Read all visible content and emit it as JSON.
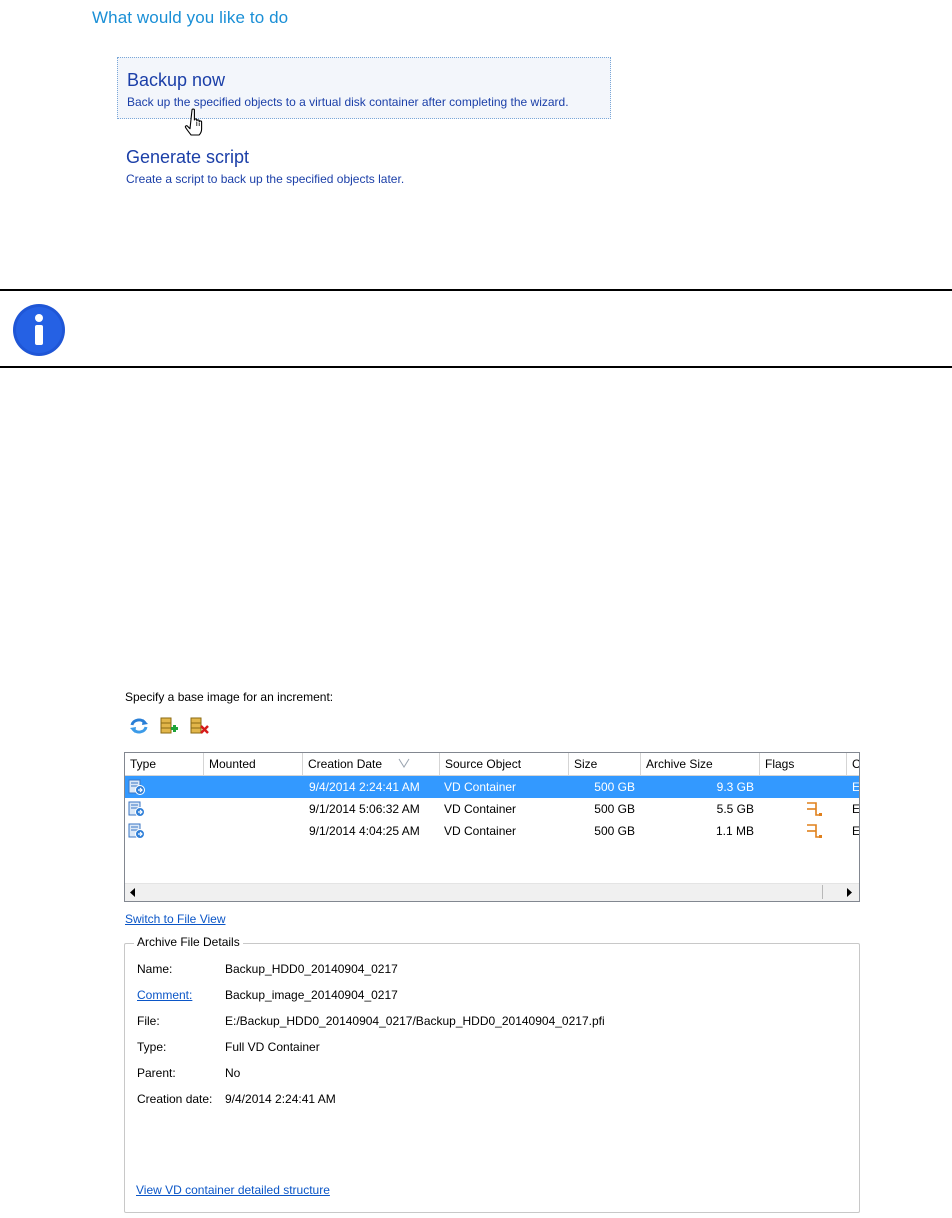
{
  "wizard": {
    "title": "What would you like to do",
    "options": [
      {
        "title": "Backup now",
        "description": "Back up the specified objects to a virtual disk container after completing the wizard."
      },
      {
        "title": "Generate script",
        "description": "Create a script to back up the specified objects later."
      }
    ]
  },
  "note": {
    "icon": "info-icon"
  },
  "base_image": {
    "label": "Specify a base image for an increment:",
    "toolbar": [
      {
        "icon": "refresh-icon"
      },
      {
        "icon": "add-archive-icon"
      },
      {
        "icon": "remove-archive-icon"
      }
    ],
    "columns": [
      "Type",
      "Mounted",
      "Creation Date",
      "Source Object",
      "Size",
      "Archive Size",
      "Flags",
      "C"
    ],
    "sorted_column": "Creation Date",
    "rows": [
      {
        "mounted": "",
        "creation_date": "9/4/2014 2:24:41 AM",
        "source_object": "VD Container",
        "size": "500 GB",
        "archive_size": "9.3 GB",
        "flag_icon": "",
        "c": "E",
        "selected": true
      },
      {
        "mounted": "",
        "creation_date": "9/1/2014 5:06:32 AM",
        "source_object": "VD Container",
        "size": "500 GB",
        "archive_size": "5.5 GB",
        "flag_icon": "branch-icon",
        "c": "E",
        "selected": false
      },
      {
        "mounted": "",
        "creation_date": "9/1/2014 4:04:25 AM",
        "source_object": "VD Container",
        "size": "500 GB",
        "archive_size": "1.1 MB",
        "flag_icon": "branch-icon",
        "c": "E",
        "selected": false
      }
    ],
    "switch_link": "Switch to File View"
  },
  "details": {
    "title": "Archive File Details",
    "fields": [
      {
        "label": "Name:",
        "value": "Backup_HDD0_20140904_0217",
        "label_is_link": false
      },
      {
        "label": "Comment:",
        "value": "Backup_image_20140904_0217",
        "label_is_link": true
      },
      {
        "label": "File:",
        "value": "E:/Backup_HDD0_20140904_0217/Backup_HDD0_20140904_0217.pfi",
        "label_is_link": false
      },
      {
        "label": "Type:",
        "value": "Full VD Container",
        "label_is_link": false
      },
      {
        "label": "Parent:",
        "value": "No",
        "label_is_link": false
      },
      {
        "label": "Creation date:",
        "value": "9/4/2014 2:24:41 AM",
        "label_is_link": false
      }
    ],
    "view_link": "View VD container detailed structure"
  },
  "colors": {
    "accent": "#1a8fd6",
    "link": "#0b56c7",
    "selection": "#3399ff",
    "option_text": "#1b3fa8"
  }
}
